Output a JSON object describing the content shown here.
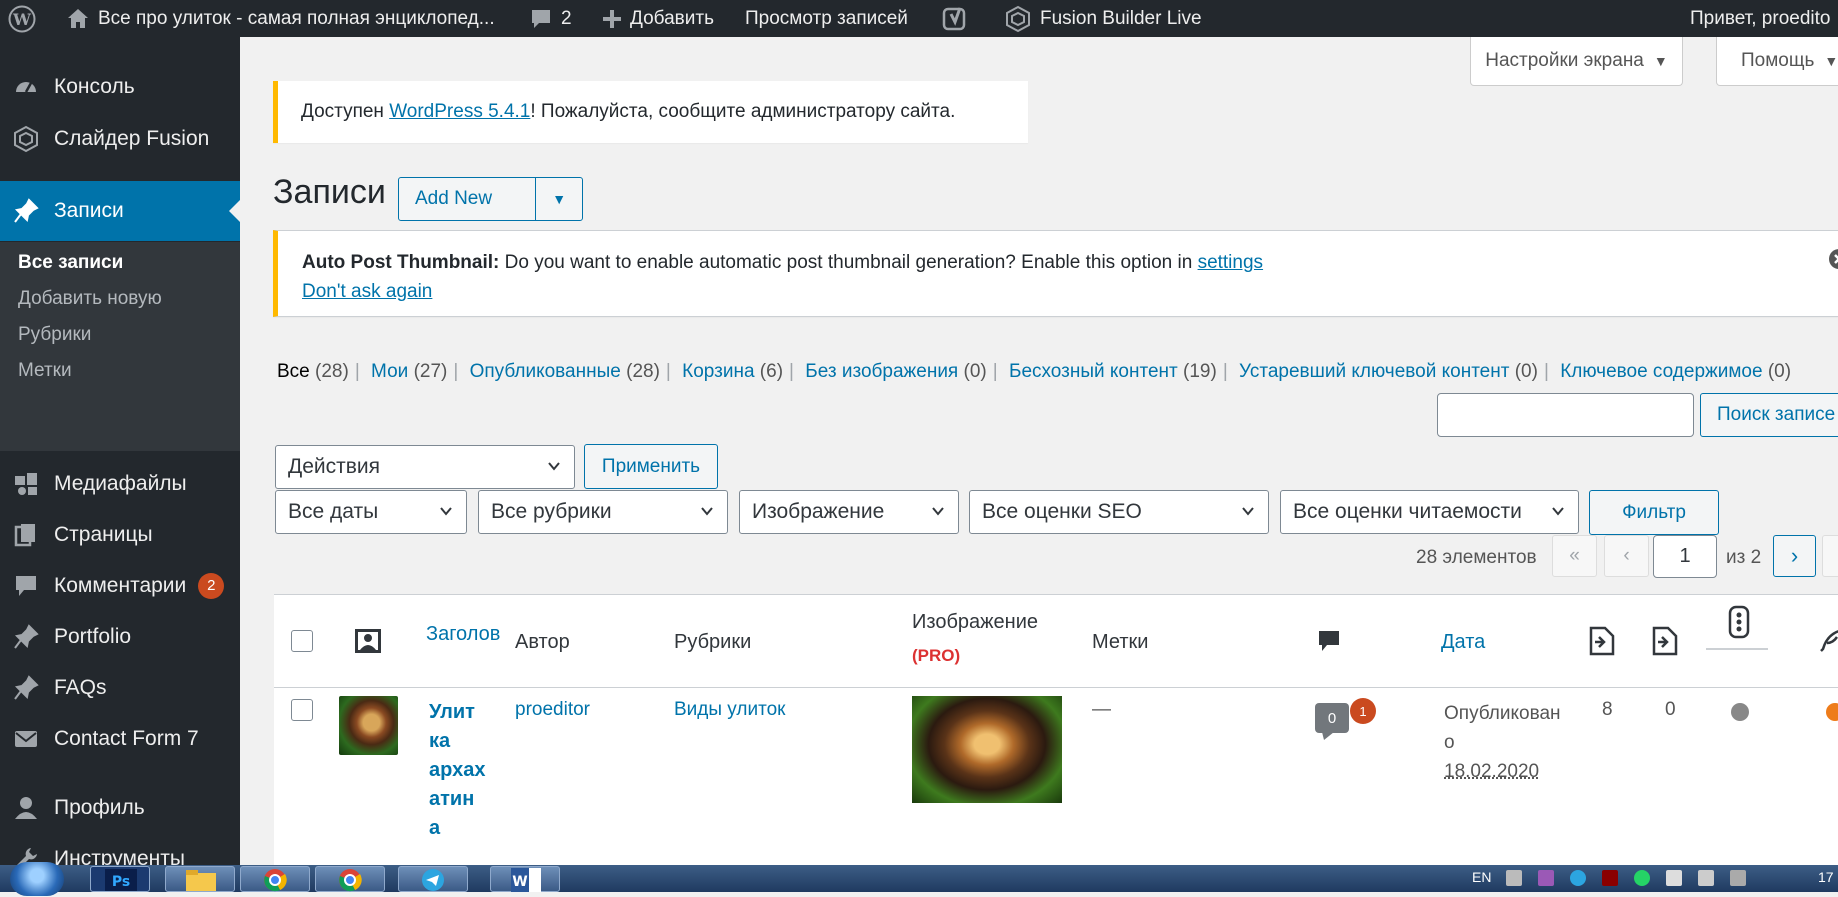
{
  "adminbar": {
    "site_title": "Все про улиток - самая полная энциклопед...",
    "comments_count": "2",
    "add_new": "Добавить",
    "view_posts": "Просмотр записей",
    "fusion_builder": "Fusion Builder Live",
    "greeting": "Привет, proedito"
  },
  "sidebar": {
    "items": [
      {
        "label": "Консоль",
        "icon": "dashboard-icon"
      },
      {
        "label": "Слайдер Fusion",
        "icon": "slider-icon"
      },
      {
        "label": "Записи",
        "icon": "pin-icon"
      },
      {
        "label": "Медиафайлы",
        "icon": "media-icon"
      },
      {
        "label": "Страницы",
        "icon": "pages-icon"
      },
      {
        "label": "Комментарии",
        "icon": "comments-icon",
        "badge": "2"
      },
      {
        "label": "Portfolio",
        "icon": "pin-icon"
      },
      {
        "label": "FAQs",
        "icon": "pin-icon"
      },
      {
        "label": "Contact Form 7",
        "icon": "mail-icon"
      },
      {
        "label": "Профиль",
        "icon": "user-icon"
      },
      {
        "label": "Инструменты",
        "icon": "wrench-icon"
      }
    ],
    "submenu": [
      "Все записи",
      "Добавить новую",
      "Рубрики",
      "Метки"
    ]
  },
  "screen_options": "Настройки экрана",
  "help": "Помощь",
  "update_notice": {
    "prefix": "Доступен ",
    "link": "WordPress 5.4.1",
    "suffix": "! Пожалуйста, сообщите администратору сайта."
  },
  "page_title": "Записи",
  "add_new_button": "Add New",
  "thumbnail_notice": {
    "strong": "Auto Post Thumbnail:",
    "text": " Do you want to enable automatic post thumbnail generation? Enable this option in ",
    "settings_link": "settings",
    "dismiss_link": "Don't ask again"
  },
  "filters_links": [
    {
      "label": "Все",
      "count": "(28)",
      "current": true
    },
    {
      "label": "Мои",
      "count": "(27)"
    },
    {
      "label": "Опубликованные",
      "count": "(28)"
    },
    {
      "label": "Корзина",
      "count": "(6)"
    },
    {
      "label": "Без изображения",
      "count": "(0)"
    },
    {
      "label": "Бесхозный контент",
      "count": "(19)"
    },
    {
      "label": "Устаревший ключевой контент",
      "count": "(0)"
    },
    {
      "label": "Ключевое содержимое",
      "count": "(0)"
    }
  ],
  "search_button": "Поиск записе",
  "bulk_actions": "Действия",
  "apply_button": "Применить",
  "filter_selects": [
    "Все даты",
    "Все рубрики",
    "Изображение",
    "Все оценки SEO",
    "Все оценки читаемости"
  ],
  "filter_button": "Фильтр",
  "pagination": {
    "total": "28 элементов",
    "first": "«",
    "prev": "‹",
    "current_page": "1",
    "of": "из 2",
    "next": "›"
  },
  "columns": {
    "title": "Заголов",
    "author": "Автор",
    "categories": "Рубрики",
    "image": "Изображение",
    "image_pro": "(PRO)",
    "tags": "Метки",
    "date": "Дата"
  },
  "rows": [
    {
      "title_lines": [
        "Улит",
        "ка",
        "архах",
        "атин",
        "а"
      ],
      "author": "proeditor",
      "category": "Виды улиток",
      "tags": "—",
      "comments_approved": "0",
      "comments_pending": "1",
      "date_status_lines": [
        "Опубликован",
        "о"
      ],
      "date": "18.02.2020",
      "links_out": "8",
      "links_in": "0"
    }
  ],
  "taskbar": {
    "lang": "EN",
    "clock": "17"
  },
  "colors": {
    "admin_dark": "#23282d",
    "accent": "#0073aa",
    "notice_warning": "#ffb900",
    "badge": "#ca4a1f",
    "pro_red": "#dc3232",
    "seo_grey": "#888888",
    "readability_orange": "#ee7c1b"
  }
}
